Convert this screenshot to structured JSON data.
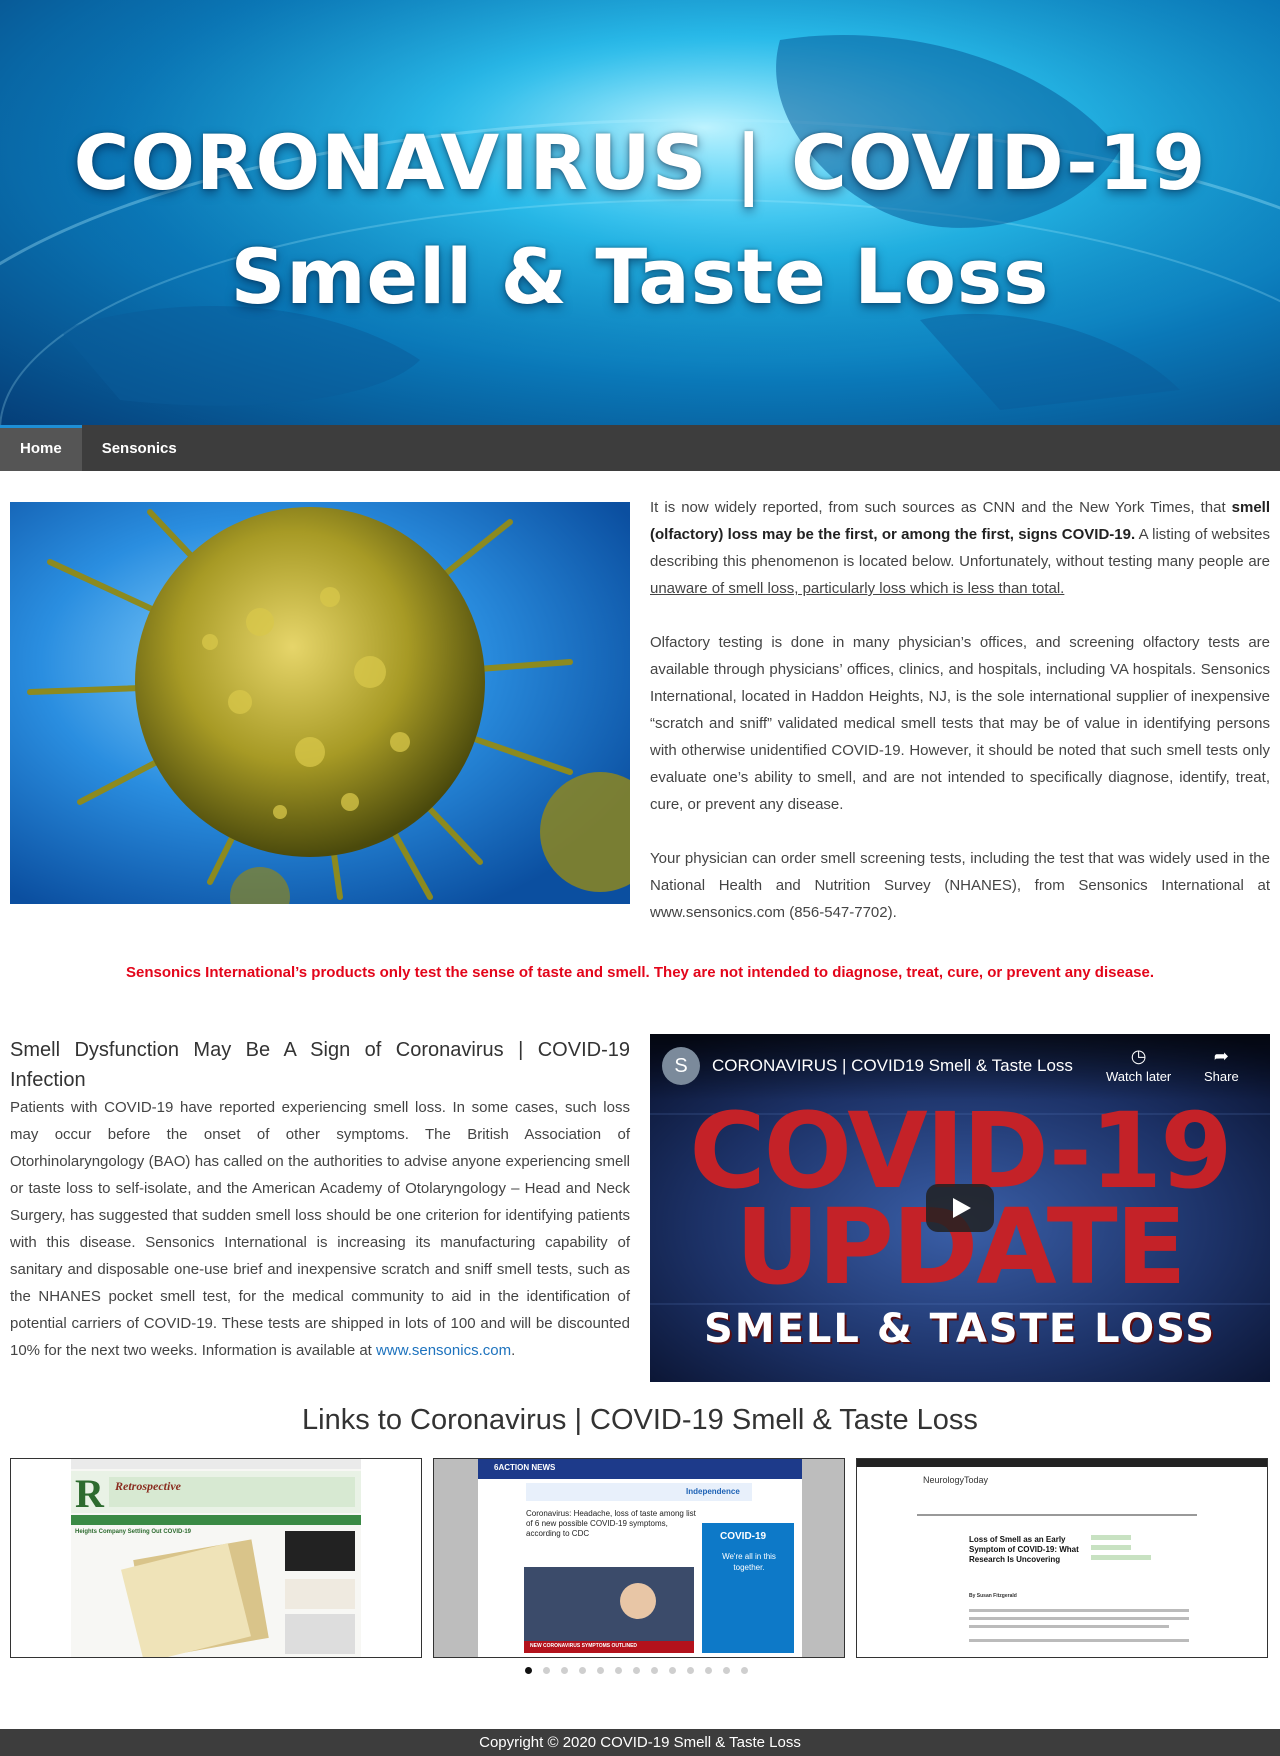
{
  "hero": {
    "line1": "CORONAVIRUS | COVID-19",
    "line2": "Smell & Taste Loss"
  },
  "nav": {
    "items": [
      {
        "label": "Home"
      },
      {
        "label": "Sensonics"
      }
    ]
  },
  "intro": {
    "p1_a": "It is now widely reported, from such sources as CNN and the New York Times, that ",
    "p1_b": "smell (olfactory) loss may be the first, or among the first, signs COVID-19.",
    "p1_c": "  A listing of websites describing this phenomenon is located below.  Unfortunately, without testing many people are ",
    "p1_d": "unaware of smell loss, particularly loss which is less than total.",
    "p2": "Olfactory testing is done in many physician’s offices, and screening olfactory tests are available through physicians’ offices, clinics, and hospitals, including VA hospitals.  Sensonics International, located in Haddon Heights, NJ, is the sole international supplier of inexpensive “scratch and sniff” validated medical smell tests that may be of value in identifying persons with otherwise unidentified COVID-19.  However, it should be noted that such smell tests only evaluate one’s ability to smell, and are not intended to specifically diagnose, identify, treat, cure, or prevent any disease.",
    "p3": "Your physician can order smell screening tests, including the test that was widely used in the National Health and Nutrition Survey (NHANES), from Sensonics International at www.sensonics.com (856-547-7702)."
  },
  "disclaimer": "Sensonics International’s products only test the sense of taste and smell. They are not intended to diagnose, treat, cure, or prevent any disease.",
  "article": {
    "heading": "Smell Dysfunction May Be A Sign of Coronavirus | COVID-19 Infection",
    "body": "Patients with COVID-19 have reported experiencing smell loss.  In some cases, such loss may occur before the onset of other symptoms.  The British Association of Otorhinolaryngology (BAO) has called on the authorities to advise anyone experiencing smell or taste loss to self-isolate, and the American Academy of Otolaryngology – Head and Neck Surgery, has suggested that sudden smell loss should be one criterion for identifying patients with this disease.  Sensonics International is increasing its manufacturing capability of sanitary and disposable one-use brief and inexpensive scratch and sniff smell tests, such as the NHANES pocket smell test, for the medical community to aid in the identification of potential carriers of COVID-19.  These tests are shipped in lots of 100 and will be discounted 10% for the next two weeks.  Information is available at ",
    "link": "www.sensonics.com",
    "end": "."
  },
  "video": {
    "avatar": "S",
    "title": "CORONAVIRUS | COVID19 Smell & Taste Loss",
    "watch_later": "Watch later",
    "share": "Share",
    "thumb_line1": "COVID-19",
    "thumb_line2": "UPDATE",
    "thumb_line3": "SMELL & TASTE LOSS"
  },
  "links": {
    "heading": "Links to Coronavirus | COVID-19 Smell & Taste Loss",
    "cards": [
      {
        "headline": "Heights Company Settling Out COVID-19",
        "banner": "Retrospective"
      },
      {
        "outlet": "6ACTION NEWS",
        "headline": "Coronavirus: Headache, loss of taste among list of 6 new possible COVID-19 symptoms, according to CDC",
        "ad": "Independence",
        "ad_title": "COVID-19",
        "ad_text": "We're all in this together.",
        "ticker": "NEW CORONAVIRUS SYMPTOMS OUTLINED"
      },
      {
        "outlet": "NeurologyToday",
        "headline": "Loss of Smell as an Early Symptom of COVID-19: What Research Is Uncovering",
        "byline": "By Susan Fitzgerald"
      }
    ],
    "dot_count": 13,
    "active_dot": 0
  },
  "footer": "Copyright © 2020 COVID-19 Smell & Taste Loss",
  "colors": {
    "nav_bg": "#3d3d3d",
    "accent": "#1e8fd6",
    "disclaimer": "#e3051a",
    "link": "#1e73be"
  },
  "icons": [
    "clock-icon",
    "share-icon",
    "play-icon",
    "chevron-left-icon",
    "chevron-right-icon"
  ]
}
